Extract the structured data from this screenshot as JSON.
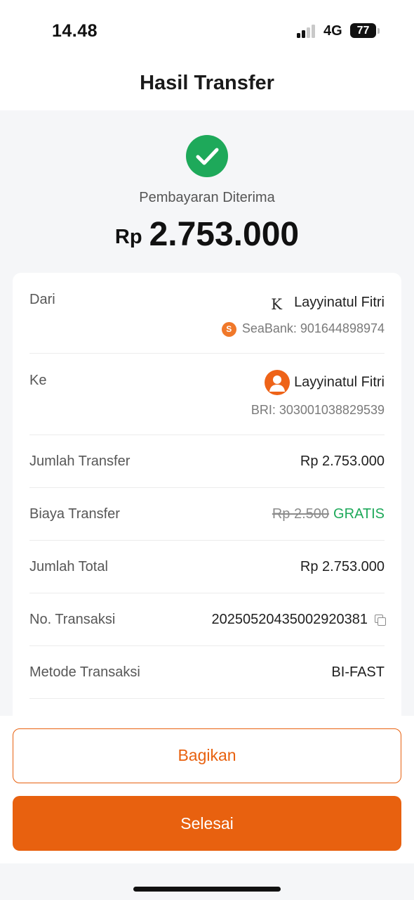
{
  "status_bar": {
    "time": "14.48",
    "network": "4G",
    "battery": "77"
  },
  "nav": {
    "title": "Hasil Transfer"
  },
  "result": {
    "status_text": "Pembayaran Diterima",
    "currency": "Rp",
    "amount": "2.753.000",
    "success_color": "#1ea95a"
  },
  "details": {
    "from": {
      "label": "Dari",
      "name": "Layyinatul Fitri",
      "account": "SeaBank: 901644898974",
      "logo_letter": "K",
      "bank_icon": "S"
    },
    "to": {
      "label": "Ke",
      "name": "Layyinatul Fitri",
      "account": "BRI: 303001038829539"
    },
    "transfer_amount": {
      "label": "Jumlah Transfer",
      "value": "Rp 2.753.000"
    },
    "fee": {
      "label": "Biaya Transfer",
      "original": "Rp 2.500",
      "value": "GRATIS"
    },
    "total": {
      "label": "Jumlah Total",
      "value": "Rp 2.753.000"
    },
    "transaction_no": {
      "label": "No. Transaksi",
      "value": "20250520435002920381"
    },
    "method": {
      "label": "Metode Transaksi",
      "value": "BI-FAST"
    }
  },
  "actions": {
    "share_label": "Bagikan",
    "done_label": "Selesai",
    "accent_color": "#e8610f"
  }
}
